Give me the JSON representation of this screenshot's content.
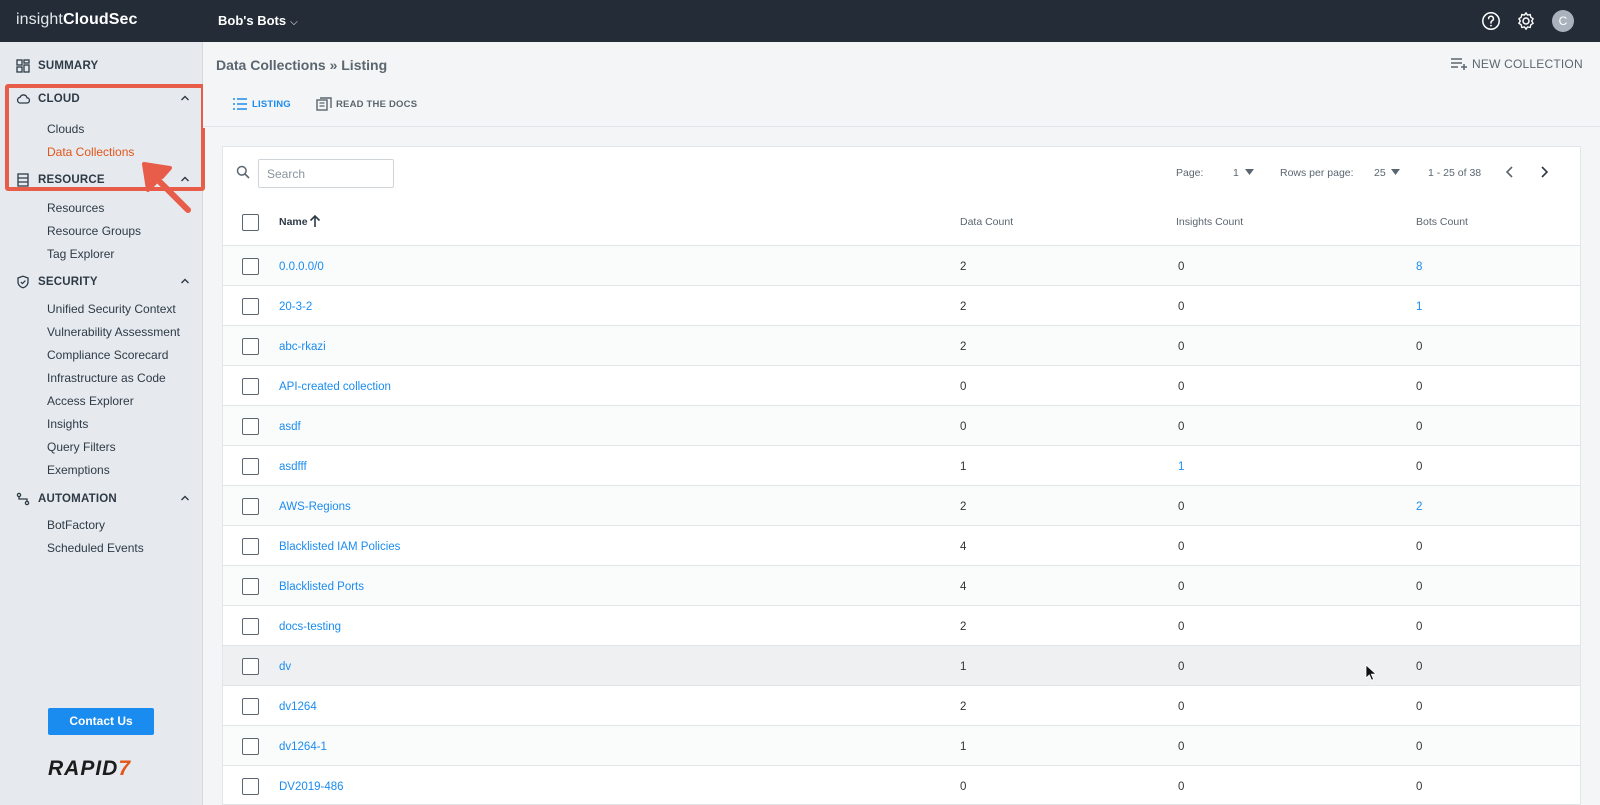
{
  "app": {
    "logo_light": "insight",
    "logo_bold": "CloudSec",
    "org_name": "Bob's Bots",
    "avatar_initial": "C"
  },
  "sidebar": {
    "summary_label": "SUMMARY",
    "cloud": {
      "label": "CLOUD",
      "items": [
        "Clouds",
        "Data Collections"
      ]
    },
    "resource": {
      "label": "RESOURCE",
      "items": [
        "Resources",
        "Resource Groups",
        "Tag Explorer"
      ]
    },
    "security": {
      "label": "SECURITY",
      "items": [
        "Unified Security Context",
        "Vulnerability Assessment",
        "Compliance Scorecard",
        "Infrastructure as Code",
        "Access Explorer",
        "Insights",
        "Query Filters",
        "Exemptions"
      ]
    },
    "automation": {
      "label": "AUTOMATION",
      "items": [
        "BotFactory",
        "Scheduled Events"
      ]
    },
    "contact_label": "Contact Us",
    "brand_text": "RAPID",
    "brand_seven": "7"
  },
  "header": {
    "breadcrumb": "Data Collections » Listing",
    "new_collection_label": "NEW COLLECTION",
    "tabs": {
      "listing": "LISTING",
      "docs": "READ THE DOCS"
    }
  },
  "toolbar": {
    "search_placeholder": "Search",
    "page_label": "Page:",
    "page_value": "1",
    "rows_label": "Rows per page:",
    "rows_value": "25",
    "range_label": "1 - 25 of 38"
  },
  "table": {
    "columns": {
      "name": "Name",
      "data_count": "Data Count",
      "insights_count": "Insights Count",
      "bots_count": "Bots Count"
    },
    "rows": [
      {
        "name": "0.0.0.0/0",
        "data": "2",
        "insights": "0",
        "bots": "8"
      },
      {
        "name": "20-3-2",
        "data": "2",
        "insights": "0",
        "bots": "1"
      },
      {
        "name": "abc-rkazi",
        "data": "2",
        "insights": "0",
        "bots": "0"
      },
      {
        "name": "API-created collection",
        "data": "0",
        "insights": "0",
        "bots": "0"
      },
      {
        "name": "asdf",
        "data": "0",
        "insights": "0",
        "bots": "0"
      },
      {
        "name": "asdfff",
        "data": "1",
        "insights": "1",
        "bots": "0"
      },
      {
        "name": "AWS-Regions",
        "data": "2",
        "insights": "0",
        "bots": "2"
      },
      {
        "name": "Blacklisted IAM Policies",
        "data": "4",
        "insights": "0",
        "bots": "0"
      },
      {
        "name": "Blacklisted Ports",
        "data": "4",
        "insights": "0",
        "bots": "0"
      },
      {
        "name": "docs-testing",
        "data": "2",
        "insights": "0",
        "bots": "0"
      },
      {
        "name": "dv",
        "data": "1",
        "insights": "0",
        "bots": "0"
      },
      {
        "name": "dv1264",
        "data": "2",
        "insights": "0",
        "bots": "0"
      },
      {
        "name": "dv1264-1",
        "data": "1",
        "insights": "0",
        "bots": "0"
      },
      {
        "name": "DV2019-486",
        "data": "0",
        "insights": "0",
        "bots": "0"
      }
    ]
  },
  "colors": {
    "accent": "#1a8cf0",
    "active_nav": "#e2551b",
    "topbar": "#232c37",
    "highlight": "#e85c4a"
  }
}
